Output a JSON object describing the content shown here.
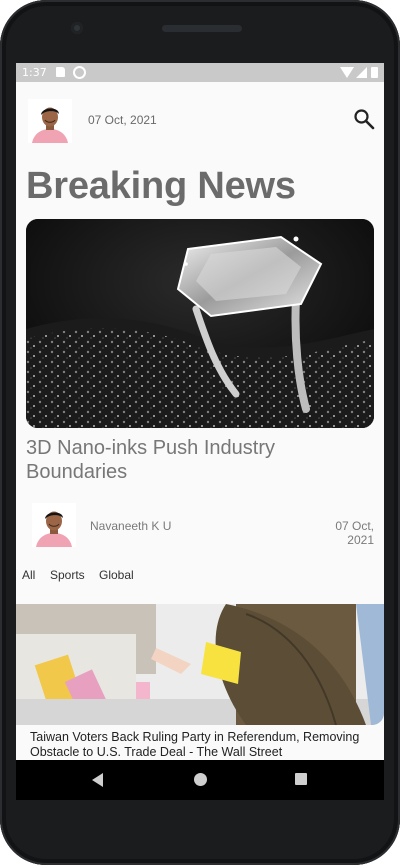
{
  "status_bar": {
    "time": "1:37"
  },
  "header": {
    "date": "07 Oct, 2021"
  },
  "page": {
    "title": "Breaking News"
  },
  "featured": {
    "title": "3D Nano-inks Push Industry Boundaries",
    "author": "Navaneeth K U",
    "date": "07 Oct, 2021"
  },
  "tabs": [
    "All",
    "Sports",
    "Global"
  ],
  "news_item": {
    "title": "Taiwan Voters Back Ruling Party in Referendum, Removing Obstacle to U.S. Trade Deal - The Wall Street"
  },
  "icons": {
    "search": "search-icon",
    "back": "back-icon",
    "home": "home-icon",
    "recent": "recent-apps-icon"
  }
}
